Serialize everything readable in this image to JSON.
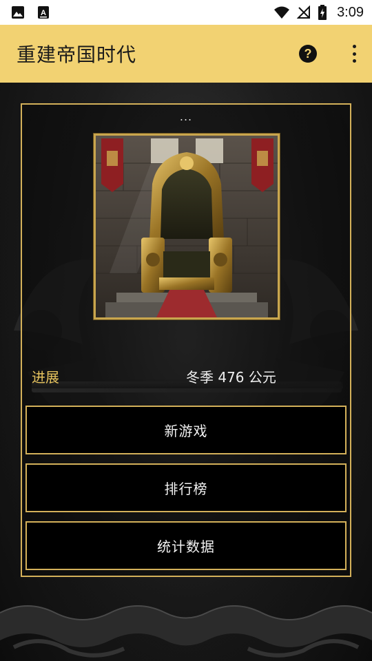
{
  "status_bar": {
    "time": "3:09",
    "icons": [
      "image-icon",
      "font-icon",
      "wifi-icon",
      "no-signal-icon",
      "battery-charging-icon"
    ]
  },
  "app_bar": {
    "title": "重建帝国时代",
    "help_label": "?",
    "color": "#f2d272"
  },
  "panel": {
    "ellipsis": "...",
    "image_name": "throne-image",
    "progress_label": "进展",
    "progress_value": "冬季 476 公元",
    "border_color": "#d4b15a"
  },
  "menu": {
    "new_game": "新游戏",
    "leaderboard": "排行榜",
    "statistics": "统计数据"
  }
}
